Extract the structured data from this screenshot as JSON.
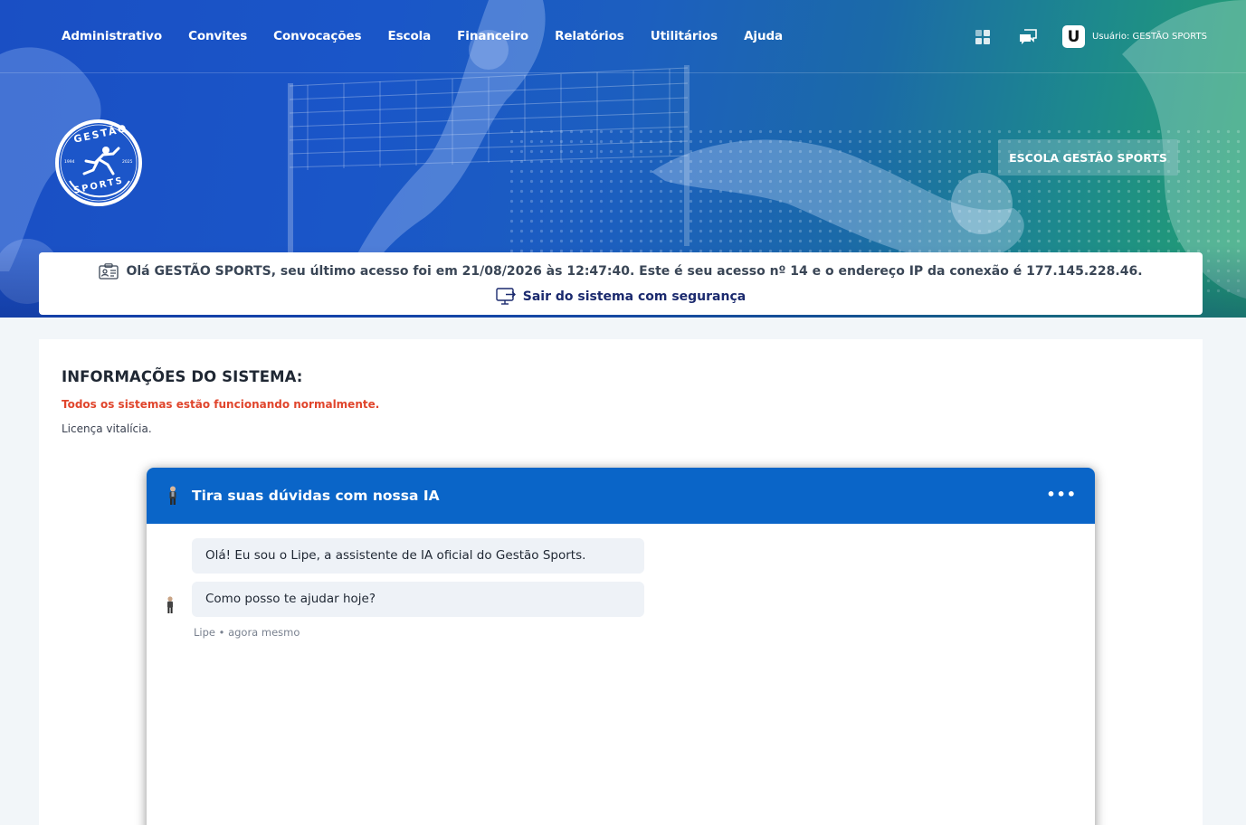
{
  "nav": {
    "items": [
      "Administrativo",
      "Convites",
      "Convocações",
      "Escola",
      "Financeiro",
      "Relatórios",
      "Utilitários",
      "Ajuda"
    ]
  },
  "tools": {
    "apps_icon": "grid-icon",
    "messages_icon": "chat-icon",
    "user_initial": "U",
    "user_label": "Usuário: GESTÃO SPORTS"
  },
  "logo": {
    "top_text": "GESTÃO",
    "bottom_text": "SPORTS",
    "year_left": "1994",
    "year_right": "2025"
  },
  "school_button": "ESCOLA GESTÃO SPORTS",
  "welcome": {
    "message": "Olá GESTÃO SPORTS, seu último acesso foi em 21/08/2026 às 12:47:40. Este é seu acesso nº 14 e o endereço IP da conexão é 177.145.228.46.",
    "logout": "Sair do sistema com segurança"
  },
  "system_info": {
    "title": "INFORMAÇÕES DO SISTEMA:",
    "status": "Todos os sistemas estão funcionando normalmente.",
    "license": "Licença vitalícia."
  },
  "chat": {
    "title": "Tira suas dúvidas com nossa IA",
    "menu": "•••",
    "messages": [
      "Olá! Eu sou o Lipe, a assistente de IA oficial do Gestão Sports.",
      "Como posso te ajudar hoje?"
    ],
    "meta": "Lipe • agora mesmo"
  },
  "colors": {
    "chat_header": "#0a65c8",
    "status_red": "#e0452c",
    "logout_navy": "#1b2a6e"
  }
}
